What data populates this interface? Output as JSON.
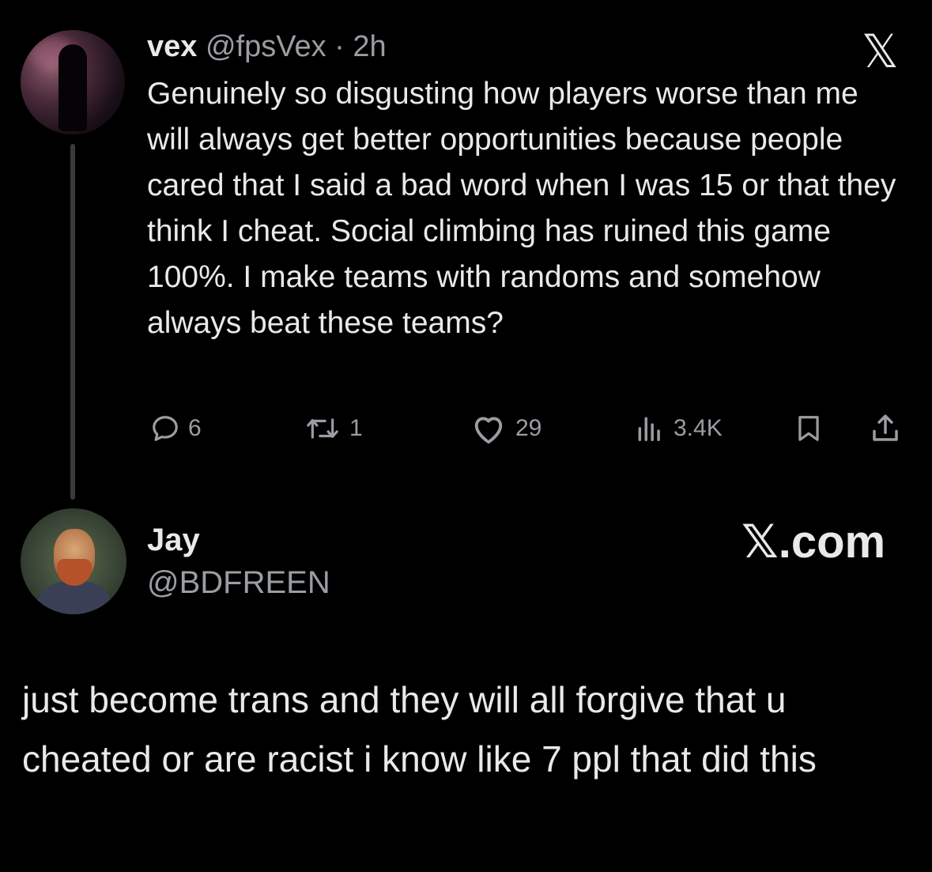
{
  "tweet": {
    "display_name": "vex",
    "handle": "@fpsVex",
    "separator": " · ",
    "time": "2h",
    "text": "Genuinely so disgusting how players worse than me will always get better opportunities because people cared that I said a bad word when I was 15 or that they think I cheat. Social climbing has ruined this game 100%. I make teams with randoms and somehow always beat these teams?",
    "platform_logo": "𝕏",
    "stats": {
      "replies": "6",
      "reposts": "1",
      "likes": "29",
      "views": "3.4K"
    },
    "icons": {
      "reply": "reply-icon",
      "repost": "repost-icon",
      "like": "heart-icon",
      "views": "views-icon",
      "bookmark": "bookmark-icon",
      "share": "share-icon"
    }
  },
  "reply": {
    "display_name": "Jay",
    "handle": "@BDFREEN",
    "source": "𝕏.com",
    "text": "just become trans and they will all forgive that u cheated or are racist i know like 7 ppl that did this"
  },
  "colors": {
    "background": "#000000",
    "text": "#e7e9ea",
    "muted": "#9a9ea3",
    "thread_line": "#3a3a3a"
  }
}
